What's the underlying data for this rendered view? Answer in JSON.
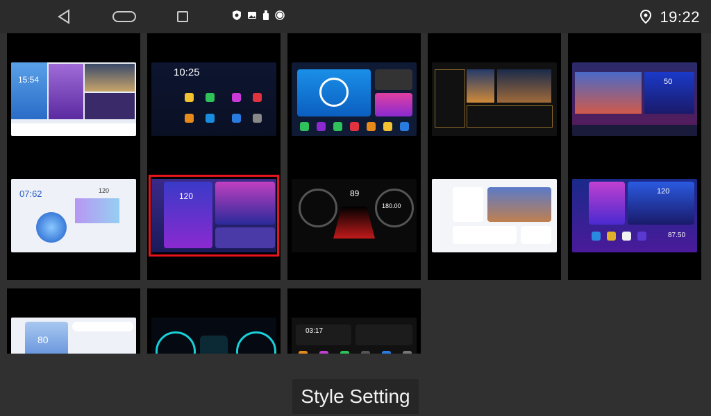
{
  "status_bar": {
    "time": "19:22",
    "icons": [
      "back-icon",
      "home-icon",
      "recents-icon",
      "shield-icon",
      "gallery-icon",
      "usb-icon",
      "circle-icon",
      "location-icon"
    ]
  },
  "thumbnails": [
    {
      "id": "style-1",
      "clock": "15:54"
    },
    {
      "id": "style-2",
      "clock": "10:25"
    },
    {
      "id": "style-3",
      "clock": ""
    },
    {
      "id": "style-4",
      "clock": ""
    },
    {
      "id": "style-5",
      "clock": "50"
    },
    {
      "id": "style-6",
      "clock": "07:62",
      "speed": "120"
    },
    {
      "id": "style-7",
      "clock": "120",
      "selected": true
    },
    {
      "id": "style-8",
      "clock": "89",
      "speed": "180.00"
    },
    {
      "id": "style-9",
      "clock": ""
    },
    {
      "id": "style-10",
      "clock": "120",
      "speed": "87.50"
    },
    {
      "id": "style-11",
      "clock": "80"
    },
    {
      "id": "style-12",
      "clock": ""
    },
    {
      "id": "style-13",
      "clock": "03:17"
    }
  ],
  "footer": {
    "title": "Style Setting"
  },
  "colors": {
    "background": "#303030",
    "tile": "#000000",
    "selection": "#e8141b"
  }
}
